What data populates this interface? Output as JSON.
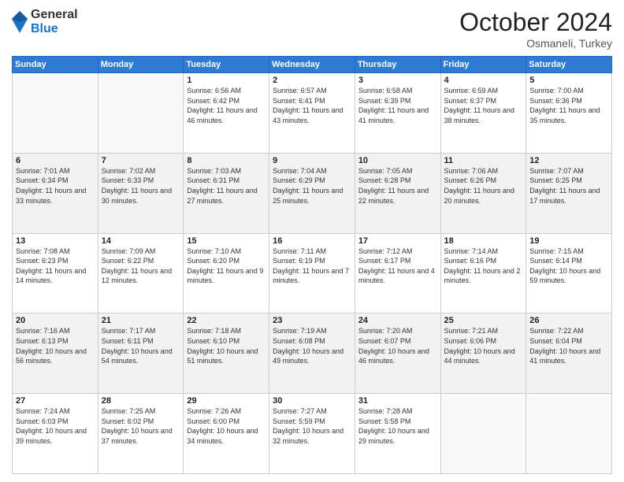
{
  "logo": {
    "general": "General",
    "blue": "Blue"
  },
  "header": {
    "month": "October 2024",
    "location": "Osmaneli, Turkey"
  },
  "days_of_week": [
    "Sunday",
    "Monday",
    "Tuesday",
    "Wednesday",
    "Thursday",
    "Friday",
    "Saturday"
  ],
  "weeks": [
    [
      {
        "day": "",
        "info": ""
      },
      {
        "day": "",
        "info": ""
      },
      {
        "day": "1",
        "sunrise": "Sunrise: 6:56 AM",
        "sunset": "Sunset: 6:42 PM",
        "daylight": "Daylight: 11 hours and 46 minutes."
      },
      {
        "day": "2",
        "sunrise": "Sunrise: 6:57 AM",
        "sunset": "Sunset: 6:41 PM",
        "daylight": "Daylight: 11 hours and 43 minutes."
      },
      {
        "day": "3",
        "sunrise": "Sunrise: 6:58 AM",
        "sunset": "Sunset: 6:39 PM",
        "daylight": "Daylight: 11 hours and 41 minutes."
      },
      {
        "day": "4",
        "sunrise": "Sunrise: 6:59 AM",
        "sunset": "Sunset: 6:37 PM",
        "daylight": "Daylight: 11 hours and 38 minutes."
      },
      {
        "day": "5",
        "sunrise": "Sunrise: 7:00 AM",
        "sunset": "Sunset: 6:36 PM",
        "daylight": "Daylight: 11 hours and 35 minutes."
      }
    ],
    [
      {
        "day": "6",
        "sunrise": "Sunrise: 7:01 AM",
        "sunset": "Sunset: 6:34 PM",
        "daylight": "Daylight: 11 hours and 33 minutes."
      },
      {
        "day": "7",
        "sunrise": "Sunrise: 7:02 AM",
        "sunset": "Sunset: 6:33 PM",
        "daylight": "Daylight: 11 hours and 30 minutes."
      },
      {
        "day": "8",
        "sunrise": "Sunrise: 7:03 AM",
        "sunset": "Sunset: 6:31 PM",
        "daylight": "Daylight: 11 hours and 27 minutes."
      },
      {
        "day": "9",
        "sunrise": "Sunrise: 7:04 AM",
        "sunset": "Sunset: 6:29 PM",
        "daylight": "Daylight: 11 hours and 25 minutes."
      },
      {
        "day": "10",
        "sunrise": "Sunrise: 7:05 AM",
        "sunset": "Sunset: 6:28 PM",
        "daylight": "Daylight: 11 hours and 22 minutes."
      },
      {
        "day": "11",
        "sunrise": "Sunrise: 7:06 AM",
        "sunset": "Sunset: 6:26 PM",
        "daylight": "Daylight: 11 hours and 20 minutes."
      },
      {
        "day": "12",
        "sunrise": "Sunrise: 7:07 AM",
        "sunset": "Sunset: 6:25 PM",
        "daylight": "Daylight: 11 hours and 17 minutes."
      }
    ],
    [
      {
        "day": "13",
        "sunrise": "Sunrise: 7:08 AM",
        "sunset": "Sunset: 6:23 PM",
        "daylight": "Daylight: 11 hours and 14 minutes."
      },
      {
        "day": "14",
        "sunrise": "Sunrise: 7:09 AM",
        "sunset": "Sunset: 6:22 PM",
        "daylight": "Daylight: 11 hours and 12 minutes."
      },
      {
        "day": "15",
        "sunrise": "Sunrise: 7:10 AM",
        "sunset": "Sunset: 6:20 PM",
        "daylight": "Daylight: 11 hours and 9 minutes."
      },
      {
        "day": "16",
        "sunrise": "Sunrise: 7:11 AM",
        "sunset": "Sunset: 6:19 PM",
        "daylight": "Daylight: 11 hours and 7 minutes."
      },
      {
        "day": "17",
        "sunrise": "Sunrise: 7:12 AM",
        "sunset": "Sunset: 6:17 PM",
        "daylight": "Daylight: 11 hours and 4 minutes."
      },
      {
        "day": "18",
        "sunrise": "Sunrise: 7:14 AM",
        "sunset": "Sunset: 6:16 PM",
        "daylight": "Daylight: 11 hours and 2 minutes."
      },
      {
        "day": "19",
        "sunrise": "Sunrise: 7:15 AM",
        "sunset": "Sunset: 6:14 PM",
        "daylight": "Daylight: 10 hours and 59 minutes."
      }
    ],
    [
      {
        "day": "20",
        "sunrise": "Sunrise: 7:16 AM",
        "sunset": "Sunset: 6:13 PM",
        "daylight": "Daylight: 10 hours and 56 minutes."
      },
      {
        "day": "21",
        "sunrise": "Sunrise: 7:17 AM",
        "sunset": "Sunset: 6:11 PM",
        "daylight": "Daylight: 10 hours and 54 minutes."
      },
      {
        "day": "22",
        "sunrise": "Sunrise: 7:18 AM",
        "sunset": "Sunset: 6:10 PM",
        "daylight": "Daylight: 10 hours and 51 minutes."
      },
      {
        "day": "23",
        "sunrise": "Sunrise: 7:19 AM",
        "sunset": "Sunset: 6:08 PM",
        "daylight": "Daylight: 10 hours and 49 minutes."
      },
      {
        "day": "24",
        "sunrise": "Sunrise: 7:20 AM",
        "sunset": "Sunset: 6:07 PM",
        "daylight": "Daylight: 10 hours and 46 minutes."
      },
      {
        "day": "25",
        "sunrise": "Sunrise: 7:21 AM",
        "sunset": "Sunset: 6:06 PM",
        "daylight": "Daylight: 10 hours and 44 minutes."
      },
      {
        "day": "26",
        "sunrise": "Sunrise: 7:22 AM",
        "sunset": "Sunset: 6:04 PM",
        "daylight": "Daylight: 10 hours and 41 minutes."
      }
    ],
    [
      {
        "day": "27",
        "sunrise": "Sunrise: 7:24 AM",
        "sunset": "Sunset: 6:03 PM",
        "daylight": "Daylight: 10 hours and 39 minutes."
      },
      {
        "day": "28",
        "sunrise": "Sunrise: 7:25 AM",
        "sunset": "Sunset: 6:02 PM",
        "daylight": "Daylight: 10 hours and 37 minutes."
      },
      {
        "day": "29",
        "sunrise": "Sunrise: 7:26 AM",
        "sunset": "Sunset: 6:00 PM",
        "daylight": "Daylight: 10 hours and 34 minutes."
      },
      {
        "day": "30",
        "sunrise": "Sunrise: 7:27 AM",
        "sunset": "Sunset: 5:59 PM",
        "daylight": "Daylight: 10 hours and 32 minutes."
      },
      {
        "day": "31",
        "sunrise": "Sunrise: 7:28 AM",
        "sunset": "Sunset: 5:58 PM",
        "daylight": "Daylight: 10 hours and 29 minutes."
      },
      {
        "day": "",
        "info": ""
      },
      {
        "day": "",
        "info": ""
      }
    ]
  ]
}
